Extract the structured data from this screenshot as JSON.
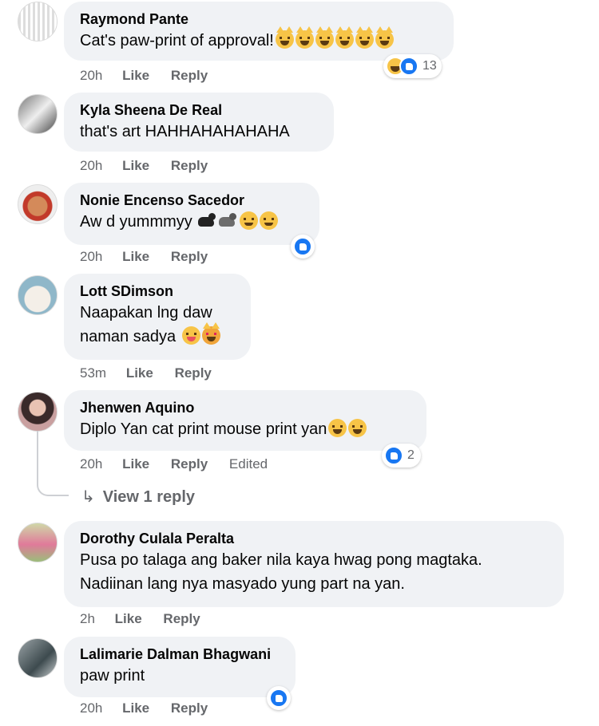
{
  "comments": [
    {
      "author": "Raymond Pante",
      "text": "Cat's paw-print of approval!",
      "time": "20h",
      "like": "Like",
      "reply": "Reply",
      "reactions": {
        "count": "13",
        "types": [
          "haha-icon",
          "like-icon"
        ]
      }
    },
    {
      "author": "Kyla Sheena De Real",
      "text": "that's art HAHHAHAHAHAHA",
      "time": "20h",
      "like": "Like",
      "reply": "Reply"
    },
    {
      "author": "Nonie Encenso Sacedor",
      "text": "Aw d yummmyy",
      "time": "20h",
      "like": "Like",
      "reply": "Reply",
      "reactions": {
        "types": [
          "like-icon"
        ]
      }
    },
    {
      "author": "Lott SDimson",
      "text_line1": "Naapakan lng daw",
      "text_line2": "naman sadya",
      "time": "53m",
      "like": "Like",
      "reply": "Reply"
    },
    {
      "author": "Jhenwen Aquino",
      "text": "Diplo Yan cat print mouse print yan",
      "time": "20h",
      "like": "Like",
      "reply": "Reply",
      "edited": "Edited",
      "reactions": {
        "count": "2",
        "types": [
          "like-icon"
        ]
      }
    },
    {
      "author": "Dorothy Culala Peralta",
      "text_line1": "Pusa po talaga ang baker nila kaya hwag pong magtaka.",
      "text_line2": "Nadiinan lang nya masyado yung part na yan.",
      "time": "2h",
      "like": "Like",
      "reply": "Reply"
    },
    {
      "author": "Lalimarie Dalman Bhagwani",
      "text": "paw print",
      "time": "20h",
      "like": "Like",
      "reply": "Reply",
      "reactions": {
        "types": [
          "like-icon"
        ]
      }
    }
  ],
  "view_replies": "View 1 reply",
  "colors": {
    "bubble": "#f0f2f5",
    "meta": "#65676b",
    "like_blue": "#1877f2",
    "emoji_yellow": "#f7c447"
  }
}
